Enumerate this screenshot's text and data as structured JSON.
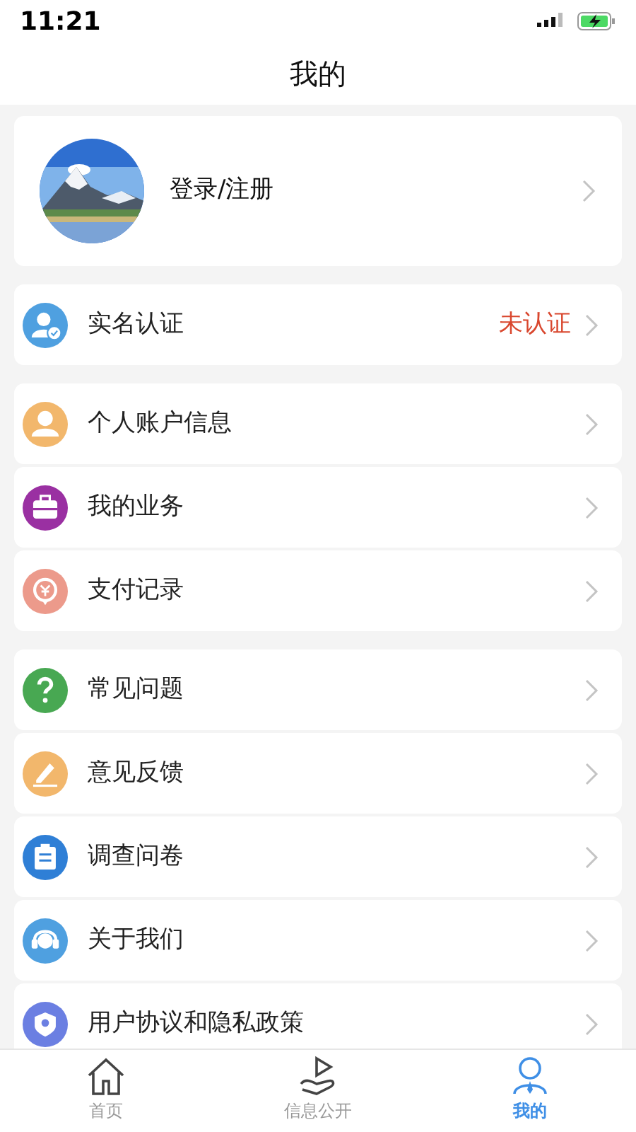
{
  "status_bar": {
    "time": "11:21"
  },
  "header": {
    "title": "我的"
  },
  "profile": {
    "label": "登录/注册"
  },
  "sections": [
    {
      "items": [
        {
          "kind": "verify",
          "label": "实名认证",
          "value": "未认证",
          "color": "#4fa0e0"
        }
      ]
    },
    {
      "items": [
        {
          "kind": "person",
          "label": "个人账户信息",
          "color": "#f2b76c"
        },
        {
          "kind": "briefcase",
          "label": "我的业务",
          "color": "#9a30a2"
        },
        {
          "kind": "coin",
          "label": "支付记录",
          "color": "#ec9a8b"
        }
      ]
    },
    {
      "items": [
        {
          "kind": "question",
          "label": "常见问题",
          "color": "#48a852"
        },
        {
          "kind": "pencil",
          "label": "意见反馈",
          "color": "#f2b76c"
        },
        {
          "kind": "clipboard",
          "label": "调查问卷",
          "color": "#2f7fd6"
        },
        {
          "kind": "headset",
          "label": "关于我们",
          "color": "#4fa0e0"
        },
        {
          "kind": "shield",
          "label": "用户协议和隐私政策",
          "color": "#6b7fe2"
        }
      ]
    }
  ],
  "tabs": [
    {
      "kind": "home",
      "label": "首页",
      "selected": false
    },
    {
      "kind": "hand",
      "label": "信息公开",
      "selected": false
    },
    {
      "kind": "user",
      "label": "我的",
      "selected": true
    }
  ]
}
